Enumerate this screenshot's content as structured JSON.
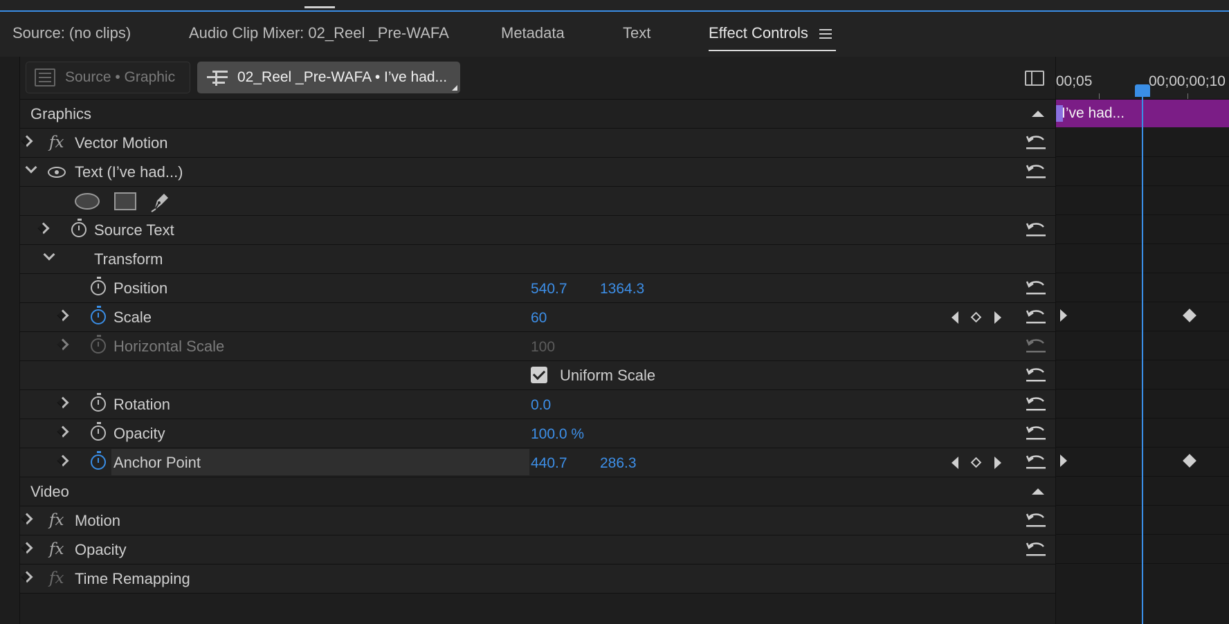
{
  "tabs": [
    {
      "label": "Source: (no clips)",
      "active": false
    },
    {
      "label": "Audio Clip Mixer: 02_Reel _Pre-WAFA",
      "active": false
    },
    {
      "label": "Metadata",
      "active": false
    },
    {
      "label": "Text",
      "active": false
    },
    {
      "label": "Effect Controls",
      "active": true
    }
  ],
  "clip_selector": {
    "source_label": "Source • Graphic",
    "sequence_label": "02_Reel _Pre-WAFA • I’ve had..."
  },
  "sections": {
    "graphics": "Graphics",
    "video": "Video"
  },
  "effects": {
    "vector_motion": "Vector Motion",
    "text_layer": "Text (I’ve had...)",
    "source_text": "Source Text",
    "transform": "Transform",
    "motion": "Motion",
    "opacity_fx": "Opacity",
    "time_remapping": "Time Remapping"
  },
  "properties": {
    "position": {
      "label": "Position",
      "x": "540.7",
      "y": "1364.3"
    },
    "scale": {
      "label": "Scale",
      "value": "60"
    },
    "horizontal_scale": {
      "label": "Horizontal Scale",
      "value": "100"
    },
    "uniform_scale": {
      "label": "Uniform Scale",
      "checked": true
    },
    "rotation": {
      "label": "Rotation",
      "value": "0.0"
    },
    "opacity": {
      "label": "Opacity",
      "value": "100.0 %"
    },
    "anchor_point": {
      "label": "Anchor Point",
      "x": "440.7",
      "y": "286.3"
    }
  },
  "timeline": {
    "timecode_left": ";00;05",
    "timecode_right": "00;00;00;10",
    "clip_label": "I’ve had..."
  },
  "colors": {
    "accent_blue": "#3a8ee6",
    "clip_purple": "#7b1d86",
    "value_blue": "#3d8fe8"
  },
  "icons": [
    "menu-icon",
    "chevron-right-icon",
    "chevron-down-icon",
    "fx-icon",
    "eye-icon",
    "stopwatch-icon",
    "reset-icon",
    "ellipse-tool-icon",
    "rectangle-tool-icon",
    "pen-tool-icon",
    "keyframe-icon",
    "panel-toggle-icon",
    "checkbox-icon"
  ]
}
